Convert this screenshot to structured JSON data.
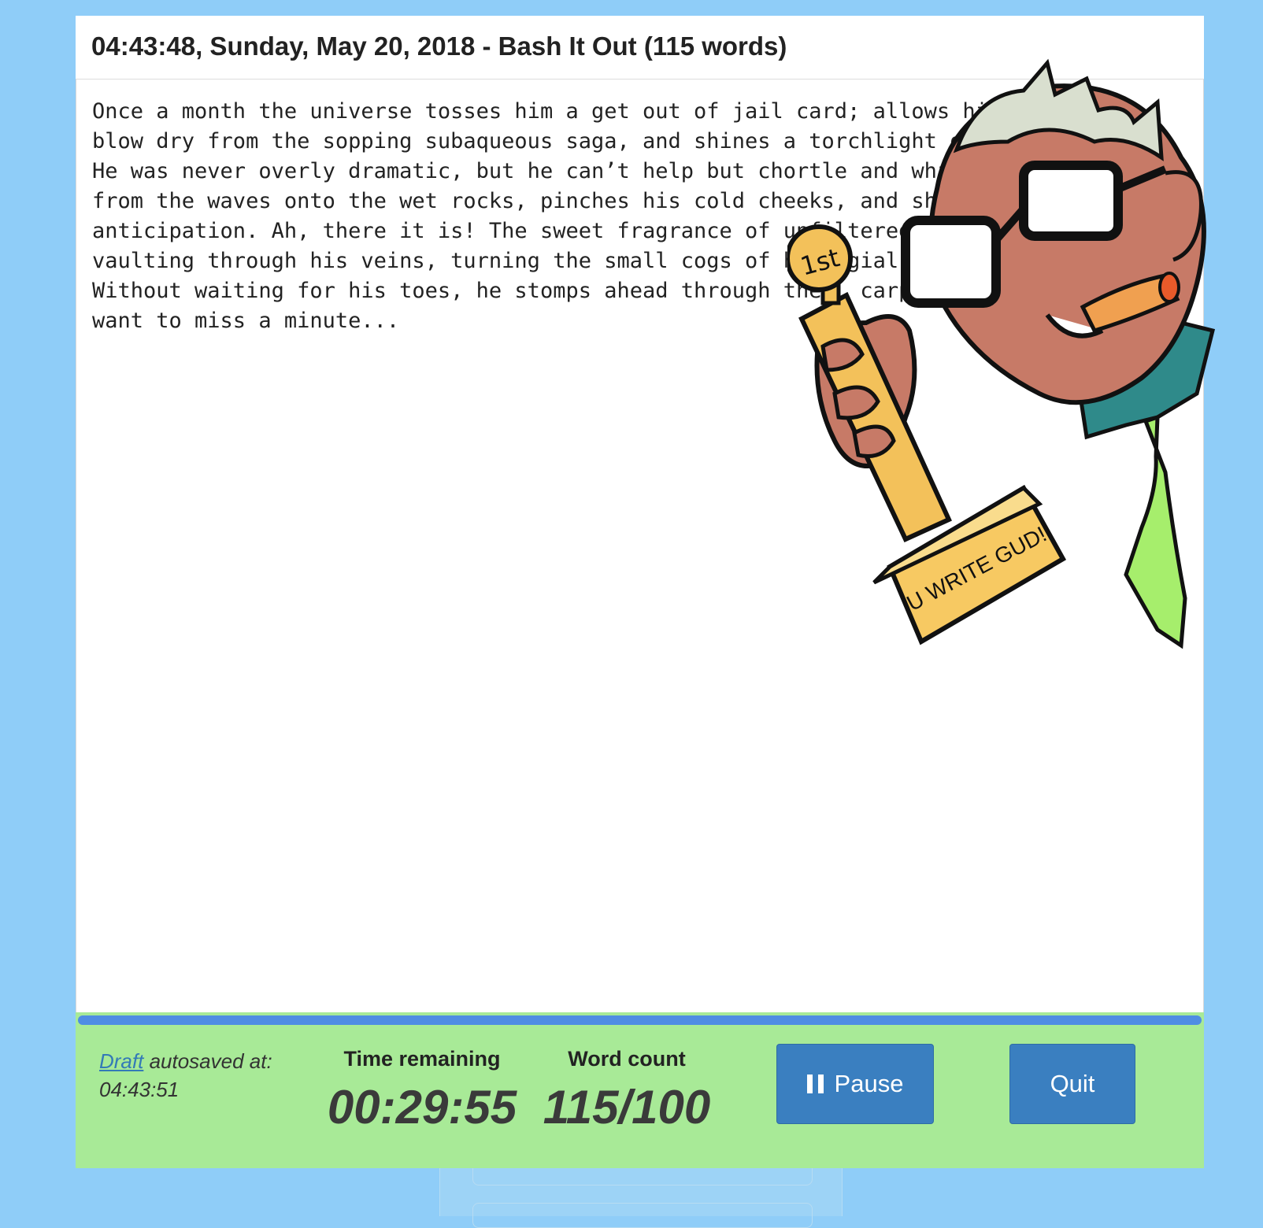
{
  "header": {
    "title": "04:43:48, Sunday, May 20, 2018 - Bash It Out (115 words)"
  },
  "editor": {
    "lines": [
      "Once a month the universe tosses him a get out of jail card; allows him",
      "blow dry from the sopping subaqueous saga, and shines a torchlight on",
      "He was never overly dramatic, but he can’t help but chortle and whist",
      "from the waves onto the wet rocks, pinches his cold cheeks, and shake",
      "anticipation. Ah, there it is! The sweet fragrance of unfiltered deh",
      "vaulting through his veins, turning the small cogs of his  gial",
      "Without waiting for his toes, he stomps ahead through the   carpet",
      "want to miss a minute..."
    ]
  },
  "mascot": {
    "trophy_badge": "1st",
    "trophy_plaque": "U WRITE GUD!"
  },
  "footer": {
    "draft_link": "Draft",
    "autosave_label": " autosaved at:",
    "autosave_time": "04:43:51",
    "time_remaining_label": "Time remaining",
    "time_remaining_value": "00:29:55",
    "word_count_label": "Word count",
    "word_count_value": "115/100",
    "pause_label": "Pause",
    "quit_label": "Quit",
    "progress": 1.0,
    "colors": {
      "footer_bg": "#a8ea97",
      "progress_fill": "#4f8de3",
      "button": "#3a7fc0",
      "page_bg": "#8fcdf8"
    }
  }
}
